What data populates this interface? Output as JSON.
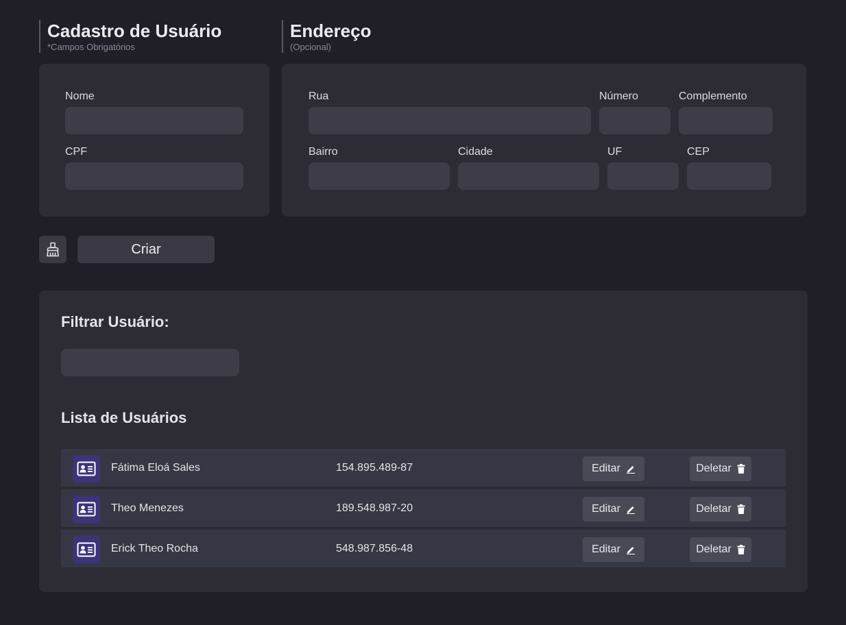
{
  "cadastro": {
    "title": "Cadastro de Usuário",
    "subtitle": "*Campos Obrigatórios",
    "fields": {
      "nome": "Nome",
      "cpf": "CPF"
    }
  },
  "endereco": {
    "title": "Endereço",
    "subtitle": "(Opcional)",
    "fields": {
      "rua": "Rua",
      "numero": "Número",
      "complemento": "Complemento",
      "bairro": "Bairro",
      "cidade": "Cidade",
      "uf": "UF",
      "cep": "CEP"
    }
  },
  "actions": {
    "clear_icon": "broom-icon",
    "create_label": "Criar"
  },
  "filter": {
    "title": "Filtrar Usuário:",
    "value": ""
  },
  "list": {
    "title": "Lista de Usuários",
    "edit_label": "Editar",
    "delete_label": "Deletar",
    "users": [
      {
        "name": "Fátima Eloá Sales",
        "cpf": "154.895.489-87"
      },
      {
        "name": "Theo Menezes",
        "cpf": "189.548.987-20"
      },
      {
        "name": "Erick Theo Rocha",
        "cpf": "548.987.856-48"
      }
    ]
  },
  "colors": {
    "background": "#201f28",
    "panel": "#2d2c35",
    "input": "#3e3d47",
    "avatar": "#3c3478",
    "row": "#363744"
  }
}
